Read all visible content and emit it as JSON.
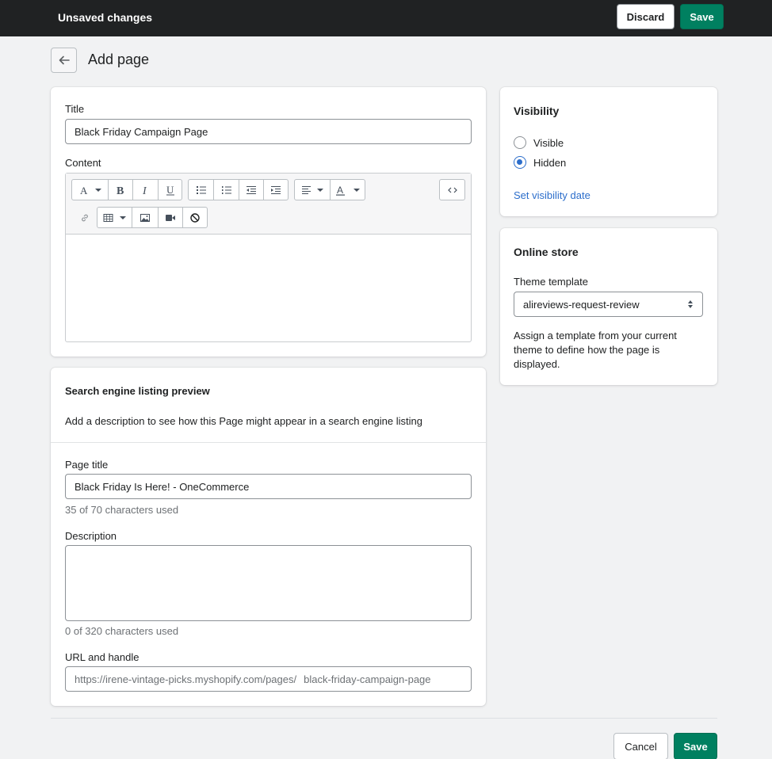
{
  "topbar": {
    "title": "Unsaved changes",
    "discard_label": "Discard",
    "save_label": "Save"
  },
  "header": {
    "back_icon": "arrow-left-icon",
    "title": "Add page"
  },
  "page_card": {
    "title_label": "Title",
    "title_value": "Black Friday Campaign Page",
    "content_label": "Content",
    "toolbar_icons": [
      "font-icon",
      "bold-icon",
      "italic-icon",
      "underline-icon",
      "bullet-list-icon",
      "numbered-list-icon",
      "outdent-icon",
      "indent-icon",
      "align-icon",
      "text-color-icon",
      "html-icon",
      "link-icon",
      "table-icon",
      "image-icon",
      "video-icon",
      "clear-format-icon"
    ]
  },
  "seo_card": {
    "heading": "Search engine listing preview",
    "description": "Add a description to see how this Page might appear in a search engine listing",
    "page_title_label": "Page title",
    "page_title_value": "Black Friday Is Here! - OneCommerce",
    "page_title_help": "35 of 70 characters used",
    "description_label": "Description",
    "description_value": "",
    "description_help": "0 of 320 characters used",
    "url_label": "URL and handle",
    "url_prefix": "https://irene-vintage-picks.myshopify.com/pages/",
    "url_handle": "black-friday-campaign-page"
  },
  "visibility_card": {
    "heading": "Visibility",
    "options": [
      {
        "label": "Visible",
        "checked": false
      },
      {
        "label": "Hidden",
        "checked": true
      }
    ],
    "link": "Set visibility date"
  },
  "online_store_card": {
    "heading": "Online store",
    "template_label": "Theme template",
    "template_value": "alireviews-request-review",
    "help": "Assign a template from your current theme to define how the page is displayed."
  },
  "footer": {
    "cancel_label": "Cancel",
    "save_label": "Save"
  },
  "colors": {
    "topbar": "#202223",
    "primary": "#008060",
    "link": "#2c6ecb",
    "background": "#f1f2f3"
  }
}
